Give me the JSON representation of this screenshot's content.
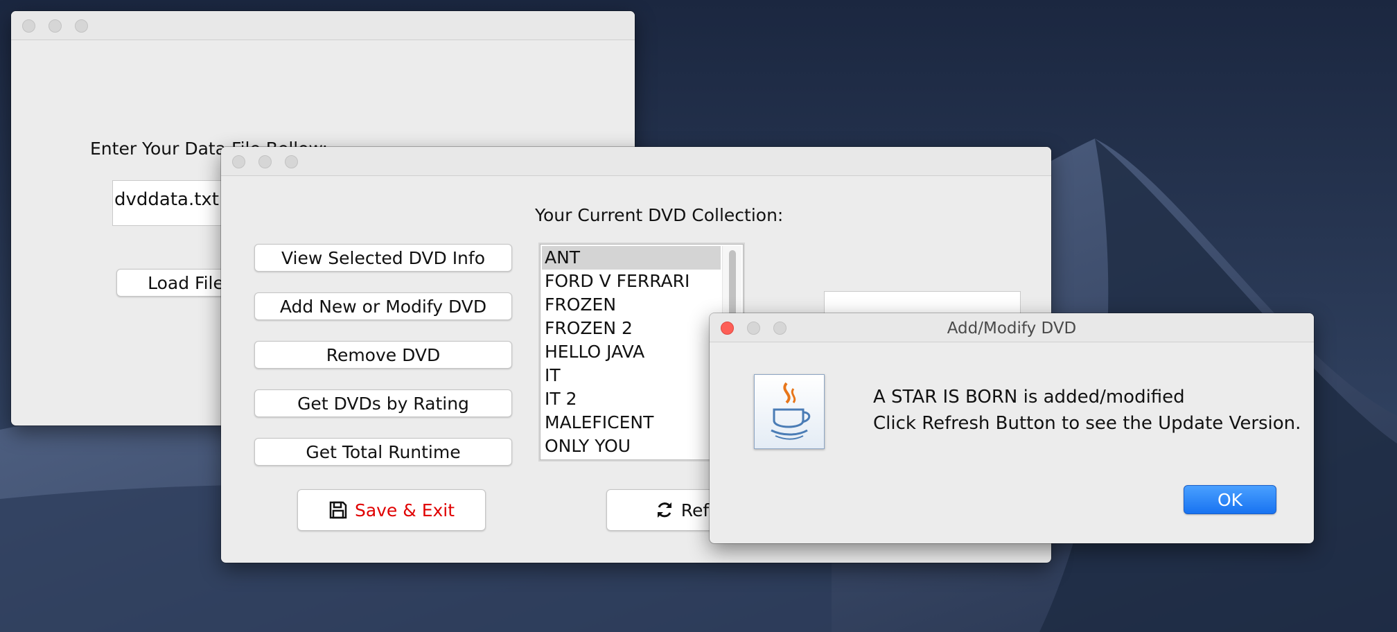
{
  "loader_window": {
    "prompt_label": "Enter Your Data File Bellow:",
    "file_field_value": "dvddata.txt",
    "load_button_label": "Load File"
  },
  "main_window": {
    "heading": "Your Current DVD Collection:",
    "buttons": {
      "view_info": "View Selected DVD Info",
      "add_modify": "Add New or Modify DVD",
      "remove": "Remove DVD",
      "by_rating": "Get DVDs by Rating",
      "total_runtime": "Get Total Runtime",
      "save_exit": "Save & Exit",
      "refresh": "Refresh"
    },
    "dvd_list": [
      "ANT",
      "FORD V FERRARI",
      "FROZEN",
      "FROZEN 2",
      "HELLO JAVA",
      "IT",
      "IT 2",
      "MALEFICENT",
      "ONLY YOU"
    ],
    "selected_dvd": "ANT"
  },
  "dialog": {
    "title": "Add/Modify DVD",
    "message_line1": "A STAR IS BORN is added/modified",
    "message_line2": "Click Refresh Button to see the Update Version.",
    "ok_label": "OK",
    "icon": "java-cup-icon"
  },
  "colors": {
    "save_exit_text": "#e00000",
    "ok_button": "#1873f1",
    "close_light": "#fd5f57"
  }
}
